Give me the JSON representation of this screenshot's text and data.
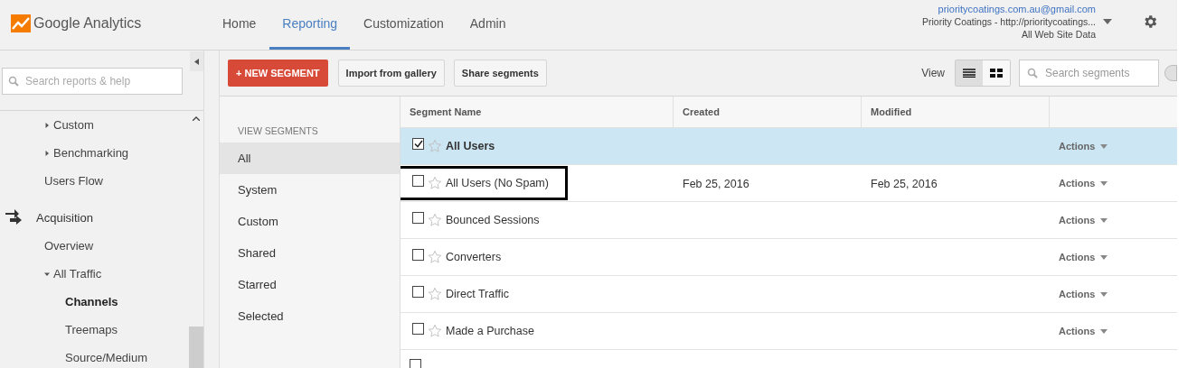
{
  "header": {
    "brand": "Google Analytics",
    "tabs": [
      {
        "label": "Home",
        "selected": false
      },
      {
        "label": "Reporting",
        "selected": true
      },
      {
        "label": "Customization",
        "selected": false
      },
      {
        "label": "Admin",
        "selected": false
      }
    ],
    "account": {
      "email": "prioritycoatings.com.au@gmail.com",
      "property": "Priority Coatings - http://prioritycoatings...",
      "view": "All Web Site Data"
    }
  },
  "sidebar": {
    "search": {
      "placeholder": "Search reports & help"
    },
    "tree": [
      {
        "kind": "group",
        "label": "Custom",
        "expanded": false
      },
      {
        "kind": "group",
        "label": "Benchmarking",
        "expanded": false
      },
      {
        "kind": "link",
        "label": "Users Flow"
      },
      {
        "kind": "section",
        "label": "Acquisition",
        "children": [
          {
            "kind": "link",
            "label": "Overview"
          },
          {
            "kind": "group",
            "label": "All Traffic",
            "expanded": true,
            "children": [
              {
                "kind": "link",
                "label": "Channels",
                "selected": true
              },
              {
                "kind": "link",
                "label": "Treemaps",
                "selected": false
              },
              {
                "kind": "link",
                "label": "Source/Medium",
                "selected": false
              }
            ]
          }
        ]
      }
    ]
  },
  "toolbar": {
    "buttons": [
      {
        "label": "+ NEW SEGMENT",
        "kind": "primary"
      },
      {
        "label": "Import from gallery",
        "kind": "secondary"
      },
      {
        "label": "Share segments",
        "kind": "secondary"
      }
    ],
    "view_label": "View",
    "view_modes": [
      {
        "kind": "list",
        "selected": true
      },
      {
        "kind": "grid",
        "selected": false
      }
    ],
    "search": {
      "placeholder": "Search segments"
    }
  },
  "segment_nav": {
    "heading": "VIEW SEGMENTS",
    "items": [
      {
        "label": "All",
        "selected": true
      },
      {
        "label": "System",
        "selected": false
      },
      {
        "label": "Custom",
        "selected": false
      },
      {
        "label": "Shared",
        "selected": false
      },
      {
        "label": "Starred",
        "selected": false
      },
      {
        "label": "Selected",
        "selected": false
      }
    ]
  },
  "table": {
    "columns": [
      "Segment Name",
      "Created",
      "Modified"
    ],
    "rows": [
      {
        "name": "All Users",
        "created": "",
        "modified": "",
        "checked": true,
        "starred": false,
        "highlighted": false,
        "action": "Actions"
      },
      {
        "name": "All Users (No Spam)",
        "created": "Feb 25, 2016",
        "modified": "Feb 25, 2016",
        "checked": false,
        "starred": false,
        "highlighted": true,
        "action": "Actions"
      },
      {
        "name": "Bounced Sessions",
        "created": "",
        "modified": "",
        "checked": false,
        "starred": false,
        "highlighted": false,
        "action": "Actions"
      },
      {
        "name": "Converters",
        "created": "",
        "modified": "",
        "checked": false,
        "starred": false,
        "highlighted": false,
        "action": "Actions"
      },
      {
        "name": "Direct Traffic",
        "created": "",
        "modified": "",
        "checked": false,
        "starred": false,
        "highlighted": false,
        "action": "Actions"
      },
      {
        "name": "Made a Purchase",
        "created": "",
        "modified": "",
        "checked": false,
        "starred": false,
        "highlighted": false,
        "action": "Actions"
      }
    ],
    "partial_row": {
      "checked": false
    }
  }
}
